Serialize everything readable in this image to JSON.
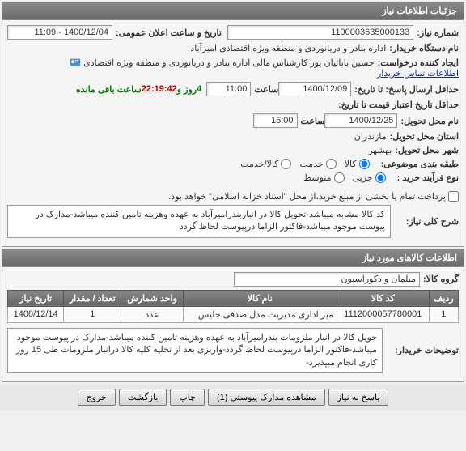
{
  "panel1": {
    "title": "جزئیات اطلاعات نیاز"
  },
  "fields": {
    "need_no_label": "شماره نیاز:",
    "need_no": "1100003635000133",
    "announce_label": "تاریخ و ساعت اعلان عمومی:",
    "announce_value": "1400/12/04 - 11:09",
    "buyer_org_label": "نام دستگاه خریدار:",
    "buyer_org": "اداره بنادر و دریانوردی و منطقه ویژه اقتصادی امیرآباد",
    "creator_label": "ایجاد کننده درخواست:",
    "creator": "حسین بابائیان پور کارشناس مالی اداره بنادر و دریانوردی و منطقه ویژه اقتصادی",
    "contact_link": "اطلاعات تماس خریدار",
    "deadline_label": "حداقل ارسال پاسخ: تا تاریخ:",
    "deadline_date": "1400/12/09",
    "time_label": "ساعت",
    "deadline_time": "11:00",
    "days_remain": "4",
    "days_unit": "روز و",
    "hours_remain": "22:19:42",
    "hours_unit": "ساعت باقی مانده",
    "credit_label": "حداقل تاریخ اعتبار قیمت تا تاریخ:",
    "delivery_dt_label": "نام محل تحویل:",
    "delivery_date": "1400/12/25",
    "delivery_time": "15:00",
    "province_label": "استان محل تحویل:",
    "province": "مازندران",
    "city_label": "شهر محل تحویل:",
    "city": "بهشهر",
    "grouping_label": "طبقه بندی موضوعی:",
    "r1": "کالا",
    "r2": "خدمت",
    "r3": "کالا/خدمت",
    "process_label": "نوع فرآیند خرید :",
    "p1": "جزیی",
    "p2": "متوسط",
    "chk_partial": "پرداخت تمام یا بخشی از مبلغ خرید،از محل \"اسناد خزانه اسلامی\" خواهد بود.",
    "summary_label": "شرح کلی نیاز:",
    "summary": "کد کالا مشابه میباشد-تحویل کالا در انباربندرامیرآباد به عهده وهزینه تامین کننده میباشد-مدارک در پیوست موجود میباشد-فاکتور الزاما درپیوست لحاظ گردد"
  },
  "panel2": {
    "title": "اطلاعات کالاهای مورد نیاز"
  },
  "item_group_label": "گروه کالا:",
  "item_group": "مبلمان و دکوراسیون",
  "table": {
    "h_row": "ردیف",
    "h_code": "کد کالا",
    "h_name": "نام کالا",
    "h_unit": "واحد شمارش",
    "h_qty": "تعداد / مقدار",
    "h_date": "تاریخ نیاز",
    "rows": [
      {
        "row": "1",
        "code": "1112000057780001",
        "name": "میز اداری مدیریت مدل صدفی جلیس",
        "unit": "عدد",
        "qty": "1",
        "date": "1400/12/14"
      }
    ]
  },
  "buyer_desc_label": "توضیحات خریدار:",
  "buyer_desc": "حویل کالا در انبار ملزومات بندرامیرآباد به عهده وهزینه تامین کننده میباشد-مدارک در پیوست موجود میباشد-فاکتور الزاما درپیوست لحاظ گردد-واریزی بعد از تخلیه کلیه کالا درانبار ملزومات طی 15 روز کاری انجام میپذیرد-",
  "buttons": {
    "reply": "پاسخ به نیاز",
    "attachments": "مشاهده مدارک پیوستی (1)",
    "print": "چاپ",
    "back": "بازگشت",
    "exit": "خروج"
  }
}
